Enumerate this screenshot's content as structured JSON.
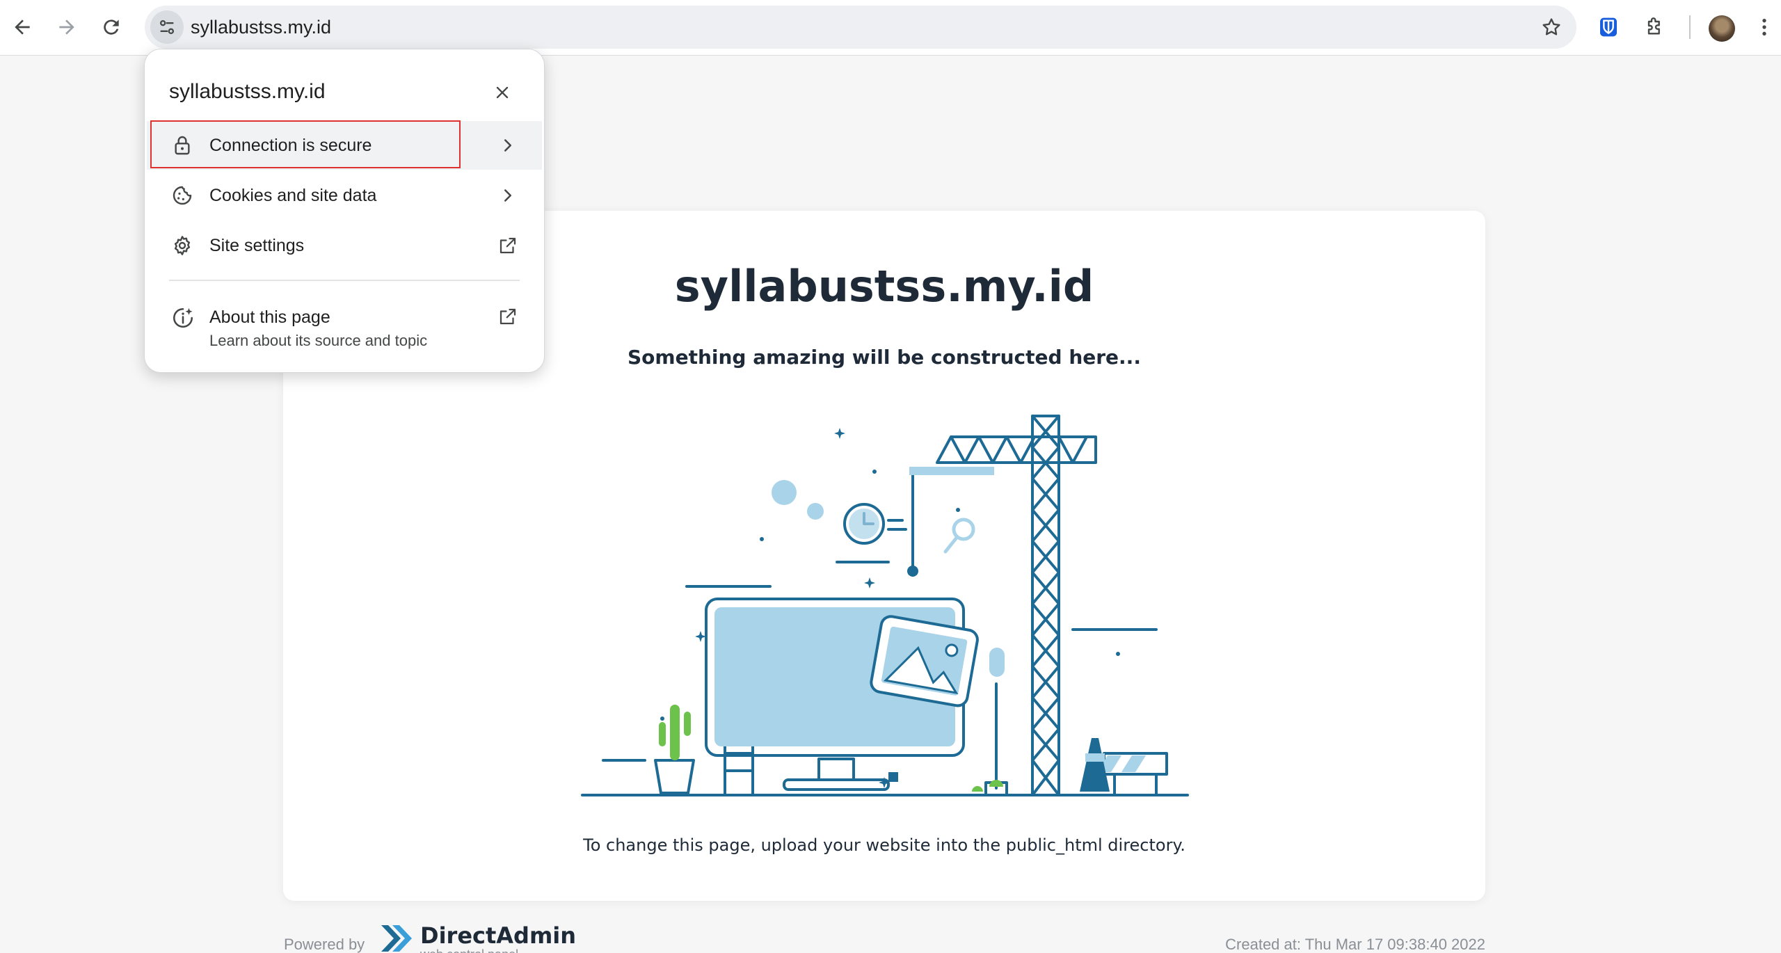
{
  "browser": {
    "url": "syllabustss.my.id",
    "icons": {
      "back": "arrow-left-icon",
      "forward": "arrow-right-icon",
      "reload": "reload-icon",
      "site_info": "tune-icon",
      "bookmark": "star-icon",
      "password_manager": "bitwarden-shield-icon",
      "extensions": "puzzle-icon",
      "menu": "vertical-dots-icon"
    }
  },
  "popup": {
    "title": "syllabustss.my.id",
    "items": [
      {
        "label": "Connection is secure",
        "icon": "lock-icon",
        "trailing": "chevron-right-icon"
      },
      {
        "label": "Cookies and site data",
        "icon": "cookie-icon",
        "trailing": "chevron-right-icon"
      },
      {
        "label": "Site settings",
        "icon": "gear-icon",
        "trailing": "external-link-icon"
      }
    ],
    "about": {
      "label": "About this page",
      "sublabel": "Learn about its source and topic",
      "icon": "info-spark-icon",
      "trailing": "external-link-icon"
    }
  },
  "page": {
    "title": "syllabustss.my.id",
    "subtitle": "Something amazing will be constructed here...",
    "instruction": "To change this page, upload your website into the public_html directory.",
    "footer": {
      "powered_by": "Powered by",
      "brand": "DirectAdmin",
      "brand_sub": "web control panel",
      "created": "Created at: Thu Mar 17 09:38:40 2022"
    }
  },
  "colors": {
    "illustration_dark": "#1d6a94",
    "illustration_light": "#a9d3e8",
    "accent_green": "#6cc24a",
    "highlight_red": "#e03131"
  }
}
